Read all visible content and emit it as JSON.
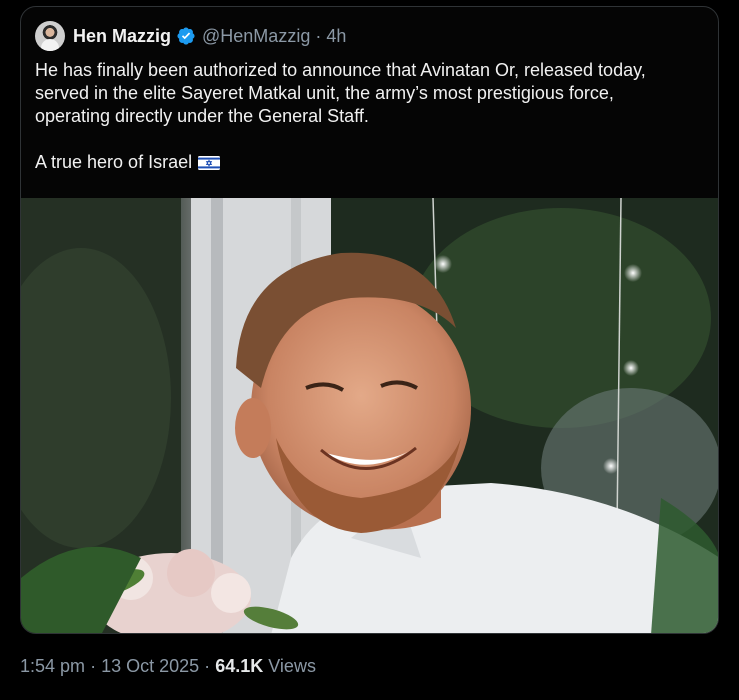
{
  "tweet": {
    "author_name": "Hen Mazzig",
    "handle": "@HenMazzig",
    "separator": "·",
    "time_ago": "4h",
    "text_lines": [
      "He has finally been authorized to announce that Avinatan Or, released today,",
      "served in the elite Sayeret Matkal unit, the army’s most prestigious force,",
      "operating directly under the General Staff."
    ],
    "text_line_last": "A true hero of Israel"
  },
  "footer": {
    "time": "1:54 pm",
    "date": "13 Oct 2025",
    "views_count": "64.1K",
    "views_label": "Views"
  },
  "colors": {
    "background": "#000000",
    "text": "#e7e9ea",
    "muted": "#8b98a5",
    "verified": "#1d9bf0"
  },
  "icons": {
    "verified": "verified-badge-icon",
    "flag": "israel-flag-icon"
  }
}
